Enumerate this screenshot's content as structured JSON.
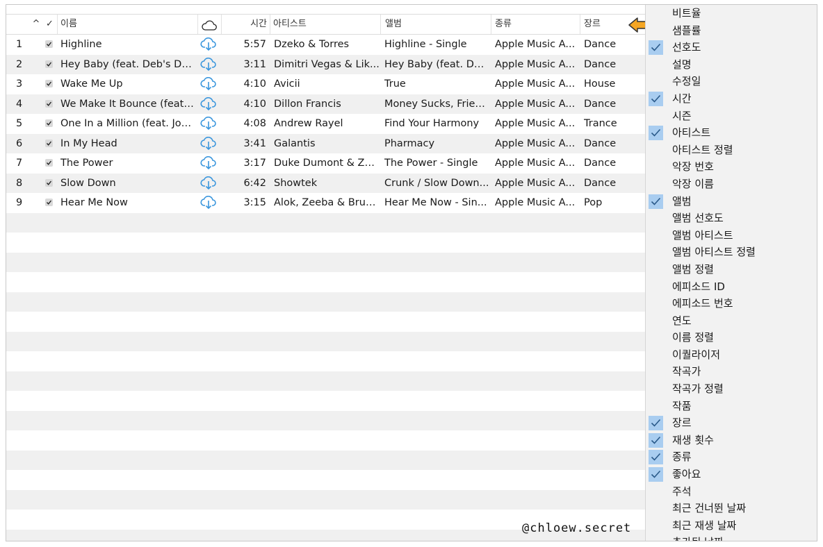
{
  "header": {
    "sort_arrow": "^",
    "check": "✓",
    "name": "이름",
    "time": "시간",
    "artist": "아티스트",
    "album": "앨범",
    "kind": "종류",
    "genre": "장르"
  },
  "tracks": [
    {
      "num": "1",
      "name": "Highline",
      "time": "5:57",
      "artist": "Dzeko & Torres",
      "album": "Highline - Single",
      "kind": "Apple Music A...",
      "genre": "Dance"
    },
    {
      "num": "2",
      "name": "Hey Baby (feat. Deb's Dau...",
      "time": "3:11",
      "artist": "Dimitri Vegas & Lik...",
      "album": "Hey Baby (feat. Deb...",
      "kind": "Apple Music A...",
      "genre": "Dance"
    },
    {
      "num": "3",
      "name": "Wake Me Up",
      "time": "4:10",
      "artist": "Avicii",
      "album": "True",
      "kind": "Apple Music A...",
      "genre": "House"
    },
    {
      "num": "4",
      "name": "We Make It Bounce (feat....",
      "time": "4:10",
      "artist": "Dillon Francis",
      "album": "Money Sucks, Frien...",
      "kind": "Apple Music A...",
      "genre": "Dance"
    },
    {
      "num": "5",
      "name": "One In a Million (feat. Jon...",
      "time": "4:08",
      "artist": "Andrew Rayel",
      "album": "Find Your Harmony",
      "kind": "Apple Music A...",
      "genre": "Trance"
    },
    {
      "num": "6",
      "name": "In My Head",
      "time": "3:41",
      "artist": "Galantis",
      "album": "Pharmacy",
      "kind": "Apple Music A...",
      "genre": "Dance"
    },
    {
      "num": "7",
      "name": "The Power",
      "time": "3:17",
      "artist": "Duke Dumont & Za...",
      "album": "The Power - Single",
      "kind": "Apple Music A...",
      "genre": "Dance"
    },
    {
      "num": "8",
      "name": "Slow Down",
      "time": "6:42",
      "artist": "Showtek",
      "album": "Crunk / Slow Down...",
      "kind": "Apple Music A...",
      "genre": "Dance"
    },
    {
      "num": "9",
      "name": "Hear Me Now",
      "time": "3:15",
      "artist": "Alok, Zeeba & Brun...",
      "album": "Hear Me Now - Sin...",
      "kind": "Apple Music A...",
      "genre": "Pop"
    }
  ],
  "column_menu": [
    {
      "label": "비트율",
      "checked": false
    },
    {
      "label": "샘플률",
      "checked": false
    },
    {
      "label": "선호도",
      "checked": true
    },
    {
      "label": "설명",
      "checked": false
    },
    {
      "label": "수정일",
      "checked": false
    },
    {
      "label": "시간",
      "checked": true
    },
    {
      "label": "시즌",
      "checked": false
    },
    {
      "label": "아티스트",
      "checked": true
    },
    {
      "label": "아티스트 정렬",
      "checked": false
    },
    {
      "label": "악장 번호",
      "checked": false
    },
    {
      "label": "악장 이름",
      "checked": false
    },
    {
      "label": "앨범",
      "checked": true
    },
    {
      "label": "앨범 선호도",
      "checked": false
    },
    {
      "label": "앨범 아티스트",
      "checked": false
    },
    {
      "label": "앨범 아티스트 정렬",
      "checked": false
    },
    {
      "label": "앨범 정렬",
      "checked": false
    },
    {
      "label": "에피소드 ID",
      "checked": false
    },
    {
      "label": "에피소드 번호",
      "checked": false
    },
    {
      "label": "연도",
      "checked": false
    },
    {
      "label": "이름 정렬",
      "checked": false
    },
    {
      "label": "이퀄라이저",
      "checked": false
    },
    {
      "label": "작곡가",
      "checked": false
    },
    {
      "label": "작곡가 정렬",
      "checked": false
    },
    {
      "label": "작품",
      "checked": false
    },
    {
      "label": "장르",
      "checked": true
    },
    {
      "label": "재생 횟수",
      "checked": true
    },
    {
      "label": "종류",
      "checked": true
    },
    {
      "label": "좋아요",
      "checked": true
    },
    {
      "label": "주석",
      "checked": false
    },
    {
      "label": "최근 건너뛴 날짜",
      "checked": false
    },
    {
      "label": "최근 재생 날짜",
      "checked": false
    },
    {
      "label": "추가된 날짜",
      "checked": false
    }
  ],
  "watermark": "@chloew.secret",
  "colors": {
    "cloud_icon": "#3a96dd",
    "arrow_fill": "#f5a623",
    "menu_check_bg": "#a9cdf0",
    "row_alt": "#f0f0f0"
  },
  "icons": {
    "cloud_header": "cloud-icon",
    "cloud_row": "cloud-download-icon",
    "pointer": "arrow-left-icon",
    "check": "checkmark-icon"
  }
}
